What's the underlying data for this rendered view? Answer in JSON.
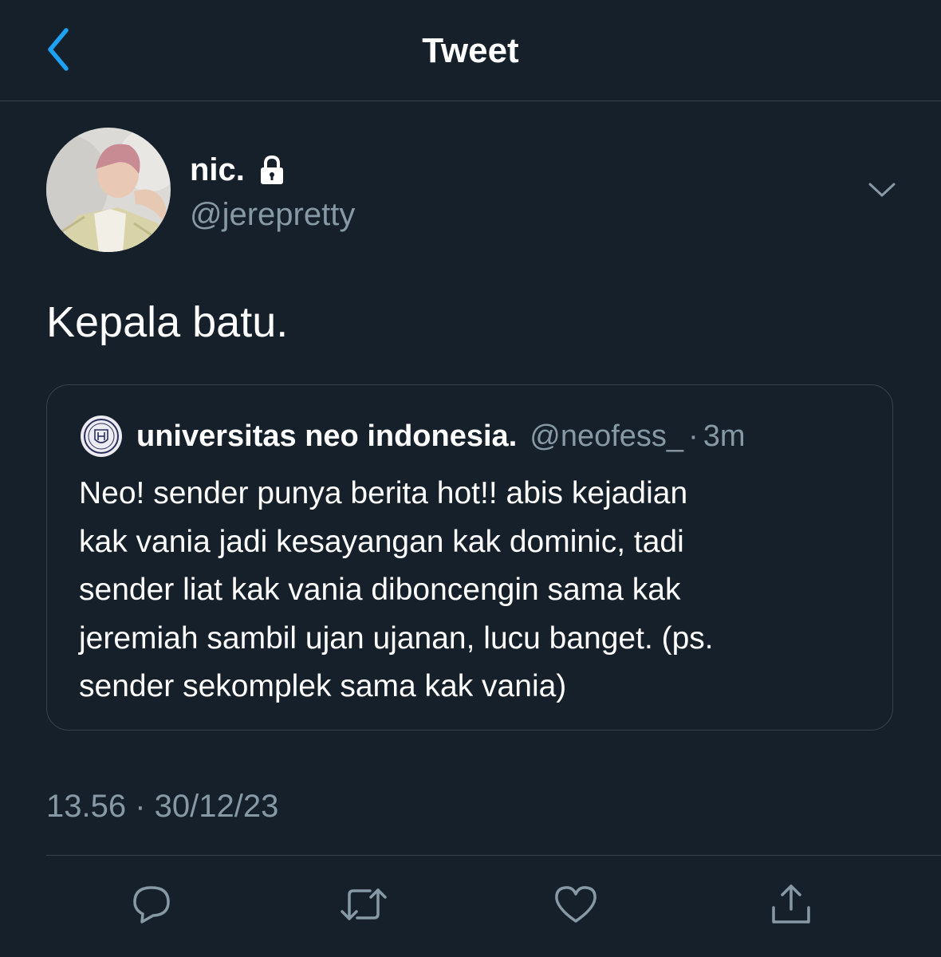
{
  "header": {
    "title": "Tweet",
    "back_icon": "chevron-left-icon"
  },
  "colors": {
    "background": "#15202b",
    "accent": "#1da1f2",
    "secondary_text": "#8899a6",
    "border": "#38444d"
  },
  "tweet": {
    "display_name": "nic.",
    "protected_icon": "lock-icon",
    "handle": "@jerepretty",
    "text": "Kepala batu.",
    "timestamp": "13.56 · 30/12/23",
    "more_icon": "chevron-down-icon"
  },
  "quoted_tweet": {
    "display_name": "universitas neo indonesia.",
    "handle": "@neofess_",
    "separator": "·",
    "time": "3m",
    "lines": [
      "Neo! sender punya berita hot!! abis kejadian",
      "kak vania jadi kesayangan kak dominic, tadi",
      "sender liat kak vania diboncengin sama kak",
      "jeremiah sambil ujan ujanan, lucu banget. (ps.",
      "sender sekomplek sama kak vania)"
    ]
  },
  "actions": [
    {
      "name": "reply",
      "icon": "reply-icon"
    },
    {
      "name": "retweet",
      "icon": "retweet-icon"
    },
    {
      "name": "like",
      "icon": "heart-icon"
    },
    {
      "name": "share",
      "icon": "share-icon"
    }
  ]
}
